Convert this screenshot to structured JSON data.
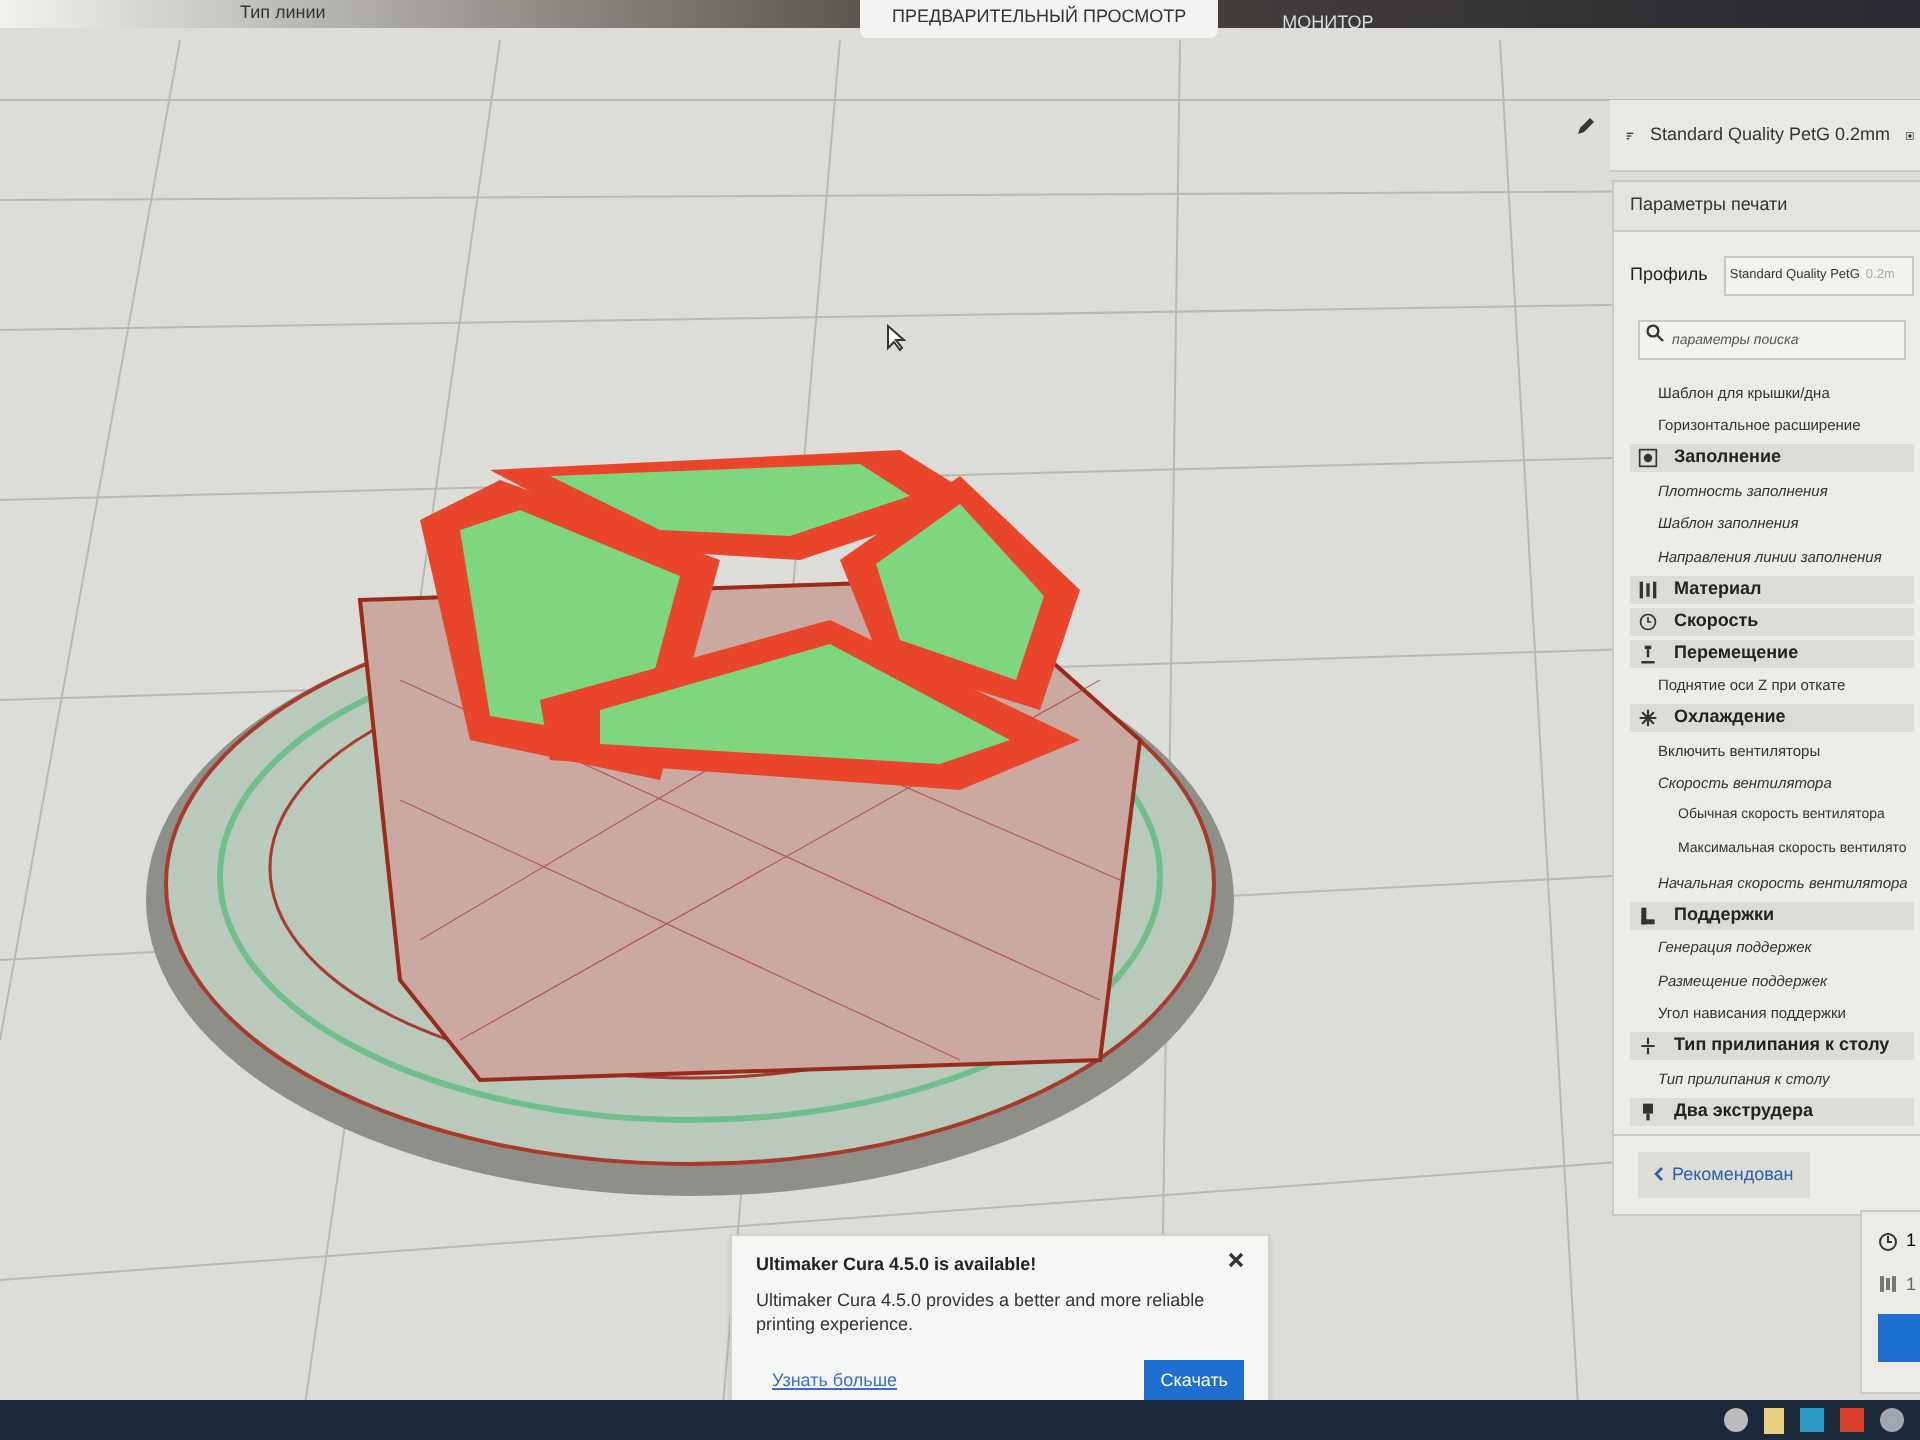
{
  "top_bar": {
    "left_label": "Тип линии",
    "tabs": [
      {
        "label": "ПРЕДВАРИТЕЛЬНЫЙ ПРОСМОТР",
        "selected": true
      },
      {
        "label": "МОНИТОР",
        "selected": false
      }
    ]
  },
  "printer_profile": {
    "title": "Standard Quality PetG 0.2mm"
  },
  "print_settings": {
    "title": "Параметры печати",
    "profile_label": "Профиль",
    "profile_value": "Standard Quality PetG",
    "profile_suffix": "0.2m",
    "search": {
      "placeholder": "параметры поиска"
    },
    "items": [
      {
        "kind": "setting",
        "label": "Шаблон для крышки/дна",
        "modified": false
      },
      {
        "kind": "setting",
        "label": "Горизонтальное расширение",
        "modified": false
      },
      {
        "kind": "category",
        "label": "Заполнение"
      },
      {
        "kind": "setting",
        "label": "Плотность заполнения",
        "modified": true
      },
      {
        "kind": "setting",
        "label": "Шаблон заполнения",
        "modified": true
      },
      {
        "kind": "setting",
        "label": "Направления линии заполнения",
        "modified": true
      },
      {
        "kind": "category",
        "label": "Материал"
      },
      {
        "kind": "category",
        "label": "Скорость"
      },
      {
        "kind": "category",
        "label": "Перемещение"
      },
      {
        "kind": "setting",
        "label": "Поднятие оси Z при откате",
        "modified": false
      },
      {
        "kind": "category",
        "label": "Охлаждение"
      },
      {
        "kind": "setting",
        "label": "Включить вентиляторы",
        "modified": false
      },
      {
        "kind": "setting",
        "label": "Скорость вентилятора",
        "modified": true,
        "children": [
          {
            "kind": "setting",
            "label": "Обычная скорость вентилятора",
            "modified": false
          },
          {
            "kind": "setting",
            "label": "Максимальная скорость вентилято",
            "modified": false
          }
        ]
      },
      {
        "kind": "setting",
        "label": "Начальная скорость вентилятора",
        "modified": true
      },
      {
        "kind": "category",
        "label": "Поддержки"
      },
      {
        "kind": "setting",
        "label": "Генерация поддержек",
        "modified": true
      },
      {
        "kind": "setting",
        "label": "Размещение поддержек",
        "modified": true
      },
      {
        "kind": "setting",
        "label": "Угол нависания поддержки",
        "modified": false
      },
      {
        "kind": "category",
        "label": "Тип прилипания к столу"
      },
      {
        "kind": "setting",
        "label": "Тип прилипания к столу",
        "modified": true
      },
      {
        "kind": "category",
        "label": "Два экструдера"
      }
    ],
    "recommended_button": "Рекомендован"
  },
  "estimates": {
    "time": "1",
    "material": "1"
  },
  "notification": {
    "title": "Ultimaker Cura 4.5.0 is available!",
    "message": "Ultimaker Cura 4.5.0 provides a better and more reliable printing experience.",
    "link": "Узнать больше",
    "button": "Скачать"
  }
}
